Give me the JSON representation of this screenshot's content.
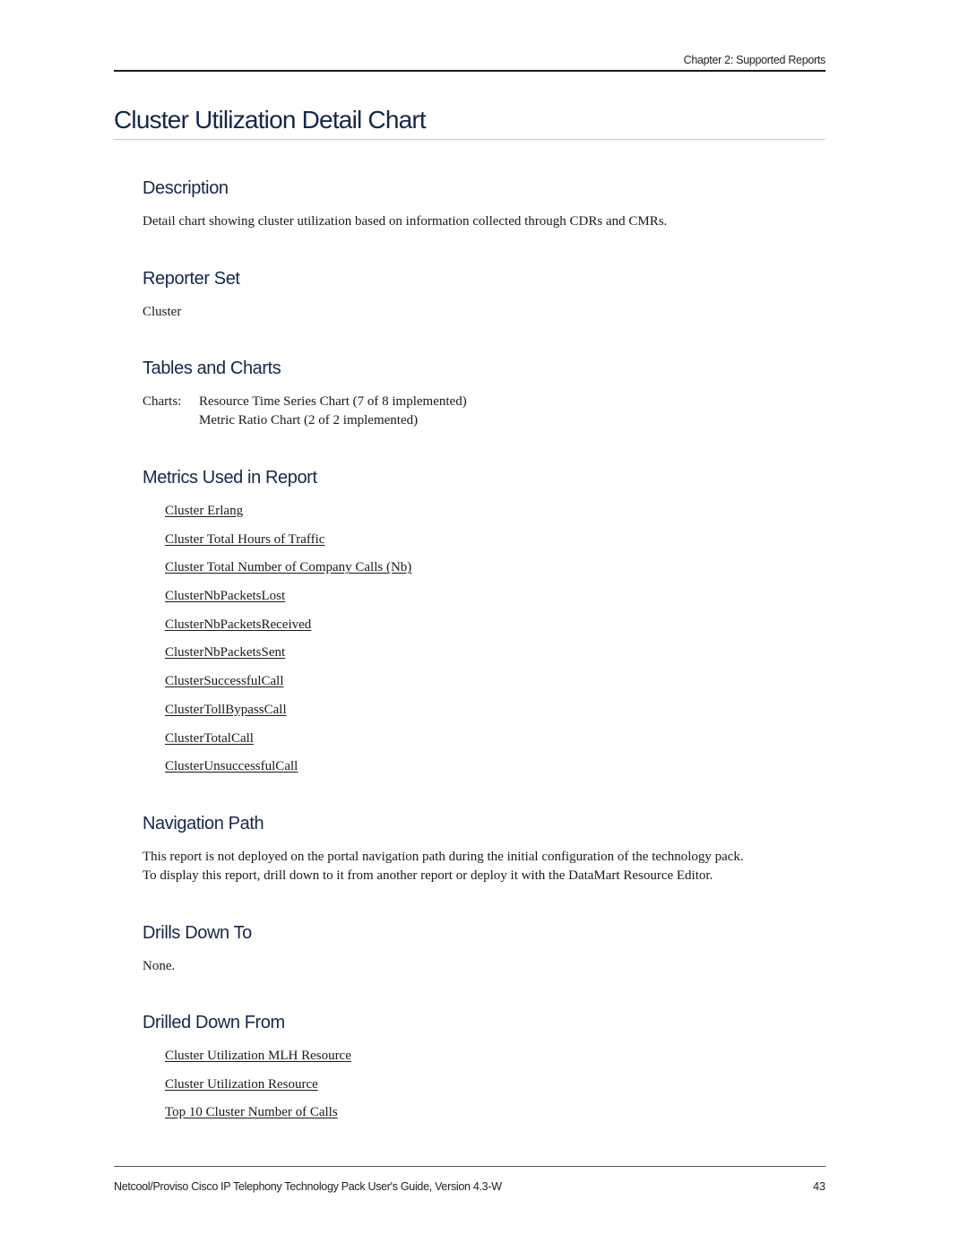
{
  "header": {
    "chapter": "Chapter 2: Supported Reports"
  },
  "page_title": "Cluster Utilization Detail Chart",
  "sections": {
    "description": {
      "heading": "Description",
      "text": "Detail chart showing cluster utilization based on information collected through CDRs and CMRs."
    },
    "reporter_set": {
      "heading": "Reporter Set",
      "text": "Cluster"
    },
    "tables_and_charts": {
      "heading": "Tables and Charts",
      "label": "Charts:",
      "items": [
        "Resource Time Series Chart (7 of 8 implemented)",
        "Metric Ratio Chart (2 of 2 implemented)"
      ]
    },
    "metrics": {
      "heading": "Metrics Used in Report",
      "links": [
        "Cluster Erlang",
        "Cluster Total Hours of Traffic",
        "Cluster Total Number of Company Calls (Nb)",
        "ClusterNbPacketsLost",
        "ClusterNbPacketsReceived",
        "ClusterNbPacketsSent",
        "ClusterSuccessfulCall",
        "ClusterTollBypassCall",
        "ClusterTotalCall",
        "ClusterUnsuccessfulCall"
      ]
    },
    "navigation_path": {
      "heading": "Navigation Path",
      "lines": [
        "This report is not deployed on the portal navigation path during the initial configuration of the technology pack.",
        "To display this report, drill down to it from another report or deploy it with the DataMart Resource Editor."
      ]
    },
    "drills_down_to": {
      "heading": "Drills Down To",
      "text": "None."
    },
    "drilled_down_from": {
      "heading": "Drilled Down From",
      "links": [
        "Cluster Utilization MLH Resource",
        "Cluster Utilization Resource",
        "Top 10 Cluster Number of Calls"
      ]
    }
  },
  "footer": {
    "guide_title": "Netcool/Proviso Cisco IP Telephony Technology Pack User's Guide, Version 4.3-W",
    "page_number": "43"
  },
  "colors": {
    "heading": "#14284b",
    "body_text": "#1a1a1a"
  }
}
